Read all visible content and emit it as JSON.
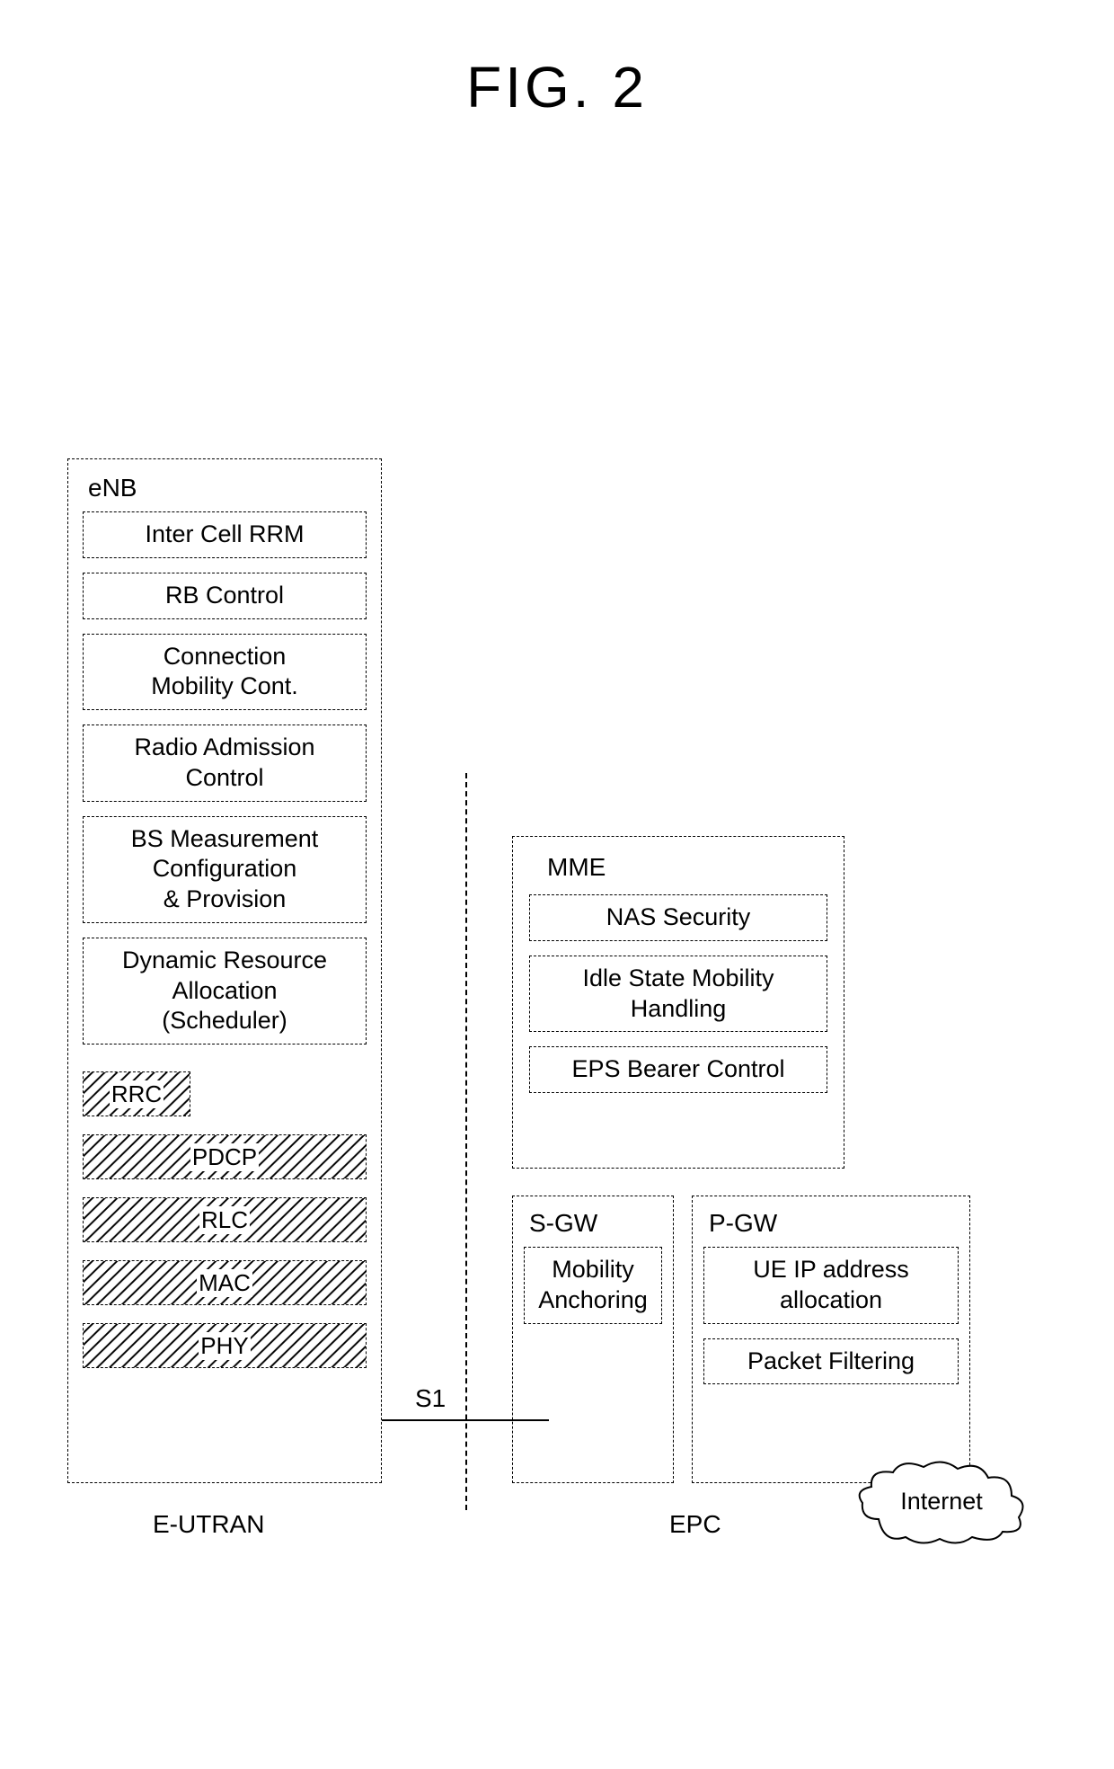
{
  "figure_title": "FIG. 2",
  "enb": {
    "title": "eNB",
    "functions": [
      "Inter Cell RRM",
      "RB Control",
      "Connection\nMobility Cont.",
      "Radio Admission\nControl",
      "BS Measurement\nConfiguration\n& Provision",
      "Dynamic Resource\nAllocation\n(Scheduler)"
    ],
    "stack": [
      "RRC",
      "PDCP",
      "RLC",
      "MAC",
      "PHY"
    ]
  },
  "interface_label": "S1",
  "mme": {
    "title": "MME",
    "functions": [
      "NAS Security",
      "Idle State Mobility\nHandling",
      "EPS Bearer Control"
    ]
  },
  "sgw": {
    "title": "S-GW",
    "functions": [
      "Mobility\nAnchoring"
    ]
  },
  "pgw": {
    "title": "P-GW",
    "functions": [
      "UE IP address\nallocation",
      "Packet Filtering"
    ]
  },
  "domain_labels": {
    "left": "E-UTRAN",
    "right": "EPC"
  },
  "internet_label": "Internet"
}
